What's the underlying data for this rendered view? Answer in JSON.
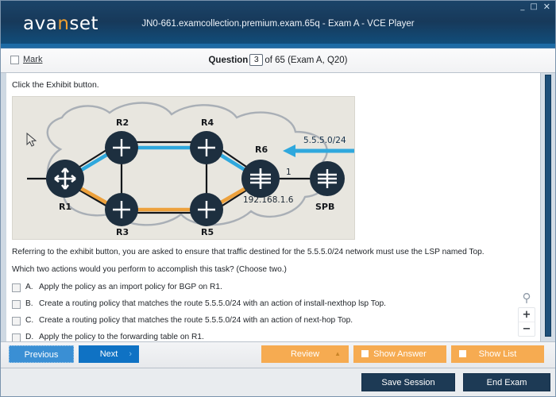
{
  "window": {
    "title": "JN0-661.examcollection.premium.exam.65q - Exam A - VCE Player",
    "logo_text_a": "ava",
    "logo_text_n": "n",
    "logo_text_b": "set",
    "minimize": "_",
    "maximize": "□",
    "close": "✕"
  },
  "question_bar": {
    "mark_label": "Mark",
    "question_word": "Question",
    "question_number": "3",
    "of_text": "of 65 (Exam A, Q20)"
  },
  "question": {
    "stem": "Click the Exhibit button.",
    "paragraph1": "Referring to the exhibit button, you are asked to ensure that traffic destined for the 5.5.5.0/24 network must use the LSP named Top.",
    "paragraph2": "Which two actions would you perform to accomplish this task? (Choose two.)",
    "options": [
      {
        "letter": "A.",
        "text": "Apply the policy as an import policy for BGP on R1."
      },
      {
        "letter": "B.",
        "text": "Create a routing policy that matches the route 5.5.5.0/24 with an action of install-nexthop lsp Top."
      },
      {
        "letter": "C.",
        "text": "Create a routing policy that matches the route 5.5.5.0/24 with an action of next-hop Top."
      },
      {
        "letter": "D.",
        "text": "Apply the policy to the forwarding table on R1."
      }
    ]
  },
  "exhibit": {
    "nodes": [
      {
        "id": "R1",
        "label": "R1"
      },
      {
        "id": "R2",
        "label": "R2"
      },
      {
        "id": "R3",
        "label": "R3"
      },
      {
        "id": "R4",
        "label": "R4"
      },
      {
        "id": "R5",
        "label": "R5"
      },
      {
        "id": "R6",
        "label": "R6"
      },
      {
        "id": "SPB",
        "label": "SPB"
      }
    ],
    "annotations": {
      "network": "5.5.5.0/24",
      "interface": "1",
      "address": "192.168.1.6"
    },
    "colors": {
      "blue_path": "#2fa8dd",
      "orange_path": "#eda13c",
      "node": "#1d2f3f",
      "cloud": "#a8aeb5",
      "background": "#e8e6df"
    }
  },
  "zoom_tool": {
    "magnifier": "search-icon",
    "zoom_in": "+",
    "zoom_out": "−"
  },
  "toolbar": {
    "previous": "Previous",
    "next": "Next",
    "next_chevron": "›",
    "review": "Review",
    "review_caret": "▲",
    "show_answer": "Show Answer",
    "show_list": "Show List"
  },
  "footer": {
    "save_session": "Save Session",
    "end_exam": "End Exam"
  },
  "colors": {
    "header_blue": "#17395a",
    "accent_orange": "#f6ab51",
    "button_blue": "#0f72c4",
    "dark_button": "#1d3a55"
  }
}
